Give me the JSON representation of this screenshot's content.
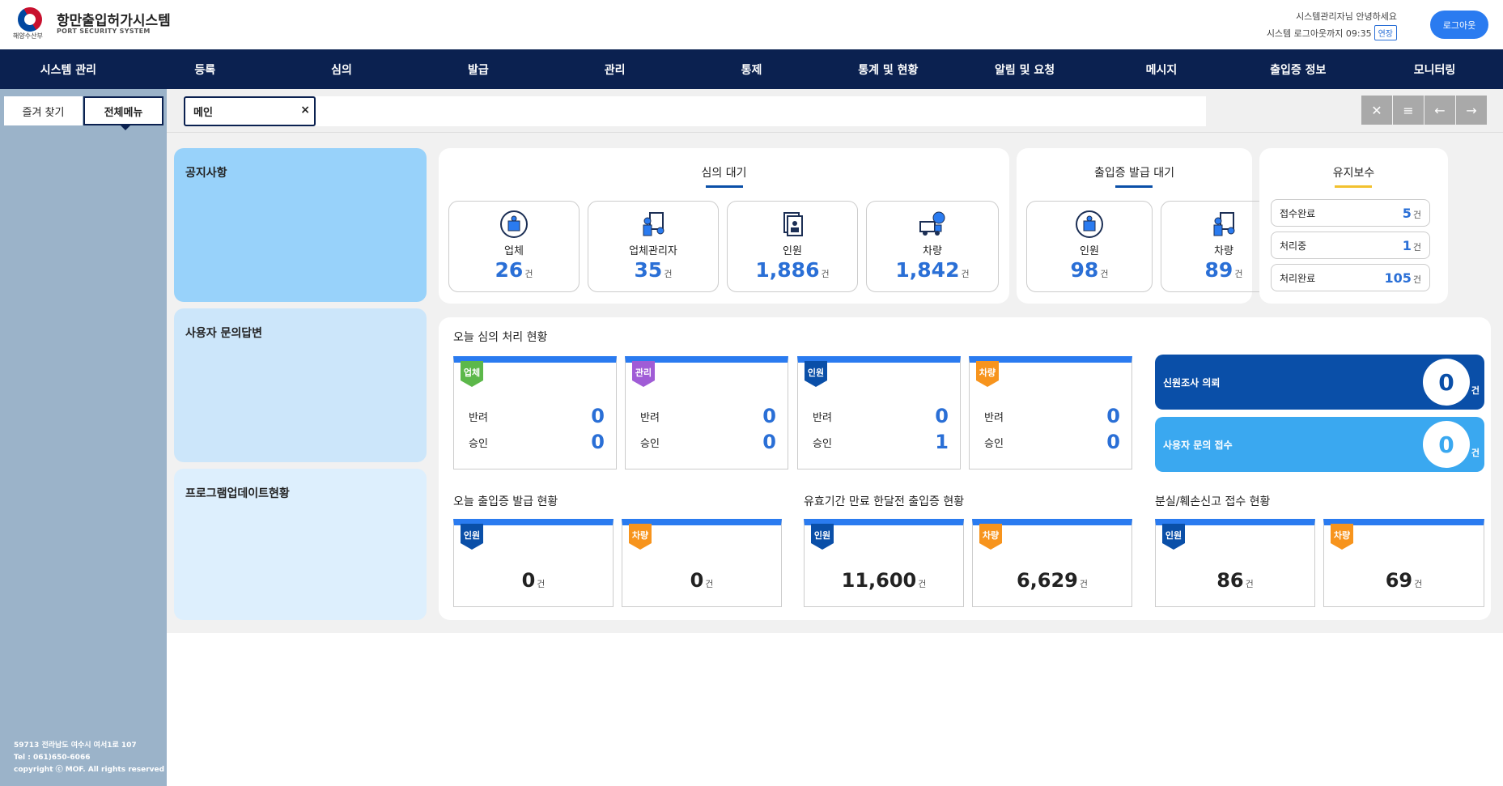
{
  "header": {
    "ministry": "해양수산부",
    "title": "항만출입허가시스템",
    "subtitle": "PORT SECURITY SYSTEM",
    "greeting": "시스템관리자님 안녕하세요",
    "logout_timer": "시스템 로그아웃까지 09:35",
    "extend": "연장",
    "logout": "로그아웃"
  },
  "nav": [
    "시스템 관리",
    "등록",
    "심의",
    "발급",
    "관리",
    "통제",
    "통계 및 현황",
    "알림 및 요청",
    "메시지",
    "출입증 정보",
    "모니터링"
  ],
  "sidebar": {
    "tab_favorites": "즐겨 찾기",
    "tab_all_menu": "전체메뉴",
    "footer_address": "59713 전라남도 여수시 여서1로 107",
    "footer_tel": "Tel : 061)650-6066",
    "footer_copyright": "copyright ⓒ MOF. All rights reserved"
  },
  "tabbar": {
    "active_tab": "메인",
    "close": "×"
  },
  "left_cards": {
    "notice": "공지사항",
    "inquiry": "사용자 문의답변",
    "update": "프로그램업데이트현황"
  },
  "review_wait": {
    "title": "심의 대기",
    "items": [
      {
        "label": "업체",
        "value": "26",
        "unit": "건"
      },
      {
        "label": "업체관리자",
        "value": "35",
        "unit": "건"
      },
      {
        "label": "인원",
        "value": "1,886",
        "unit": "건"
      },
      {
        "label": "차량",
        "value": "1,842",
        "unit": "건"
      }
    ]
  },
  "issue_wait": {
    "title": "출입증 발급 대기",
    "items": [
      {
        "label": "인원",
        "value": "98",
        "unit": "건"
      },
      {
        "label": "차량",
        "value": "89",
        "unit": "건"
      }
    ]
  },
  "maintenance": {
    "title": "유지보수",
    "items": [
      {
        "label": "접수완료",
        "value": "5",
        "unit": "건"
      },
      {
        "label": "처리중",
        "value": "1",
        "unit": "건"
      },
      {
        "label": "처리완료",
        "value": "105",
        "unit": "건"
      }
    ]
  },
  "today_review": {
    "title": "오늘 심의 처리 현황",
    "cards": [
      {
        "badge": "업체",
        "color": "#5cb84a",
        "reject_label": "반려",
        "reject": "0",
        "approve_label": "승인",
        "approve": "0"
      },
      {
        "badge": "관리",
        "color": "#a05cd6",
        "reject_label": "반려",
        "reject": "0",
        "approve_label": "승인",
        "approve": "0"
      },
      {
        "badge": "인원",
        "color": "#0a4fa8",
        "reject_label": "반려",
        "reject": "0",
        "approve_label": "승인",
        "approve": "1"
      },
      {
        "badge": "차량",
        "color": "#f7941d",
        "reject_label": "반려",
        "reject": "0",
        "approve_label": "승인",
        "approve": "0"
      }
    ]
  },
  "background_check": {
    "label": "신원조사 의뢰",
    "value": "0",
    "unit": "건",
    "color": "#0a4fa8"
  },
  "user_inquiry": {
    "label": "사용자 문의 접수",
    "value": "0",
    "unit": "건",
    "color": "#3aa8f0"
  },
  "today_issue": {
    "title": "오늘 출입증 발급 현황",
    "cards": [
      {
        "badge": "인원",
        "value": "0",
        "unit": "건"
      },
      {
        "badge": "차량",
        "value": "0",
        "unit": "건"
      }
    ]
  },
  "expiring": {
    "title": "유효기간 만료 한달전 출입증 현황",
    "cards": [
      {
        "badge": "인원",
        "value": "11,600",
        "unit": "건"
      },
      {
        "badge": "차량",
        "value": "6,629",
        "unit": "건"
      }
    ]
  },
  "lost": {
    "title": "분실/훼손신고 접수 현황",
    "cards": [
      {
        "badge": "인원",
        "value": "86",
        "unit": "건"
      },
      {
        "badge": "차량",
        "value": "69",
        "unit": "건"
      }
    ]
  },
  "colors": {
    "navy": "#0b2150",
    "blue": "#2a7bf0",
    "orange": "#f7941d",
    "gold": "#f2c12e"
  }
}
